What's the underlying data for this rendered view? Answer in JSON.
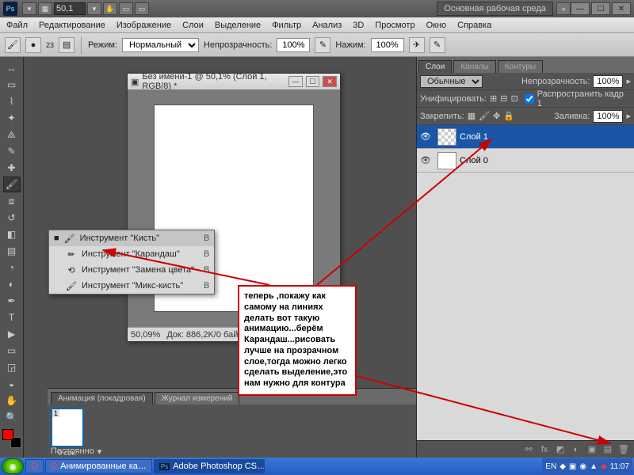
{
  "titlebar": {
    "zoom_value": "50,1",
    "workspace_btn": "Основная рабочая среда"
  },
  "menu": {
    "file": "Файл",
    "edit": "Редактирование",
    "image": "Изображение",
    "layers": "Слои",
    "select": "Выделение",
    "filter": "Фильтр",
    "analysis": "Анализ",
    "threeD": "3D",
    "view": "Просмотр",
    "window": "Окно",
    "help": "Справка"
  },
  "optbar": {
    "brush_size": "23",
    "mode_lbl": "Режим:",
    "mode_val": "Нормальный",
    "opacity_lbl": "Непрозрачность:",
    "opacity_val": "100%",
    "flow_lbl": "Нажим:",
    "flow_val": "100%"
  },
  "doc": {
    "title": "Без имени-1 @ 50,1% (Слой 1, RGB/8) *",
    "zoom": "50,09%",
    "info": "Док: 886,2K/0 бай"
  },
  "flyout": {
    "items": [
      {
        "label": "Инструмент \"Кисть\"",
        "key": "B"
      },
      {
        "label": "Инструмент \"Карандаш\"",
        "key": "B"
      },
      {
        "label": "Инструмент \"Замена цвета\"",
        "key": "B"
      },
      {
        "label": "Инструмент \"Микс-кисть\"",
        "key": "B"
      }
    ]
  },
  "anim": {
    "tab1": "Анимация (покадровая)",
    "tab2": "Журнал измерений",
    "frame_num": "1",
    "frame_time": "0 сек.",
    "loop": "Постоянно"
  },
  "layers_panel": {
    "tab_layers": "Слои",
    "tab_channels": "Каналы",
    "tab_paths": "Контуры",
    "blend": "Обычные",
    "opacity_lbl": "Непрозрачность:",
    "opacity_val": "100%",
    "unify_lbl": "Унифицировать:",
    "propagate": "Распространить кадр 1",
    "lock_lbl": "Закрепить:",
    "fill_lbl": "Заливка:",
    "fill_val": "100%",
    "layer1": "Слой 1",
    "layer0": "Слой 0"
  },
  "annotation": "теперь ,покажу как самому на линиях делать вот такую анимацию...берём Карандаш...рисовать лучше на прозрачном слое,тогда можно легко сделать выделение,это нам нужно для контура",
  "taskbar": {
    "btn1": "Анимированные ка…",
    "btn2": "Adobe Photoshop CS…",
    "lang": "EN",
    "time": "11:07"
  }
}
